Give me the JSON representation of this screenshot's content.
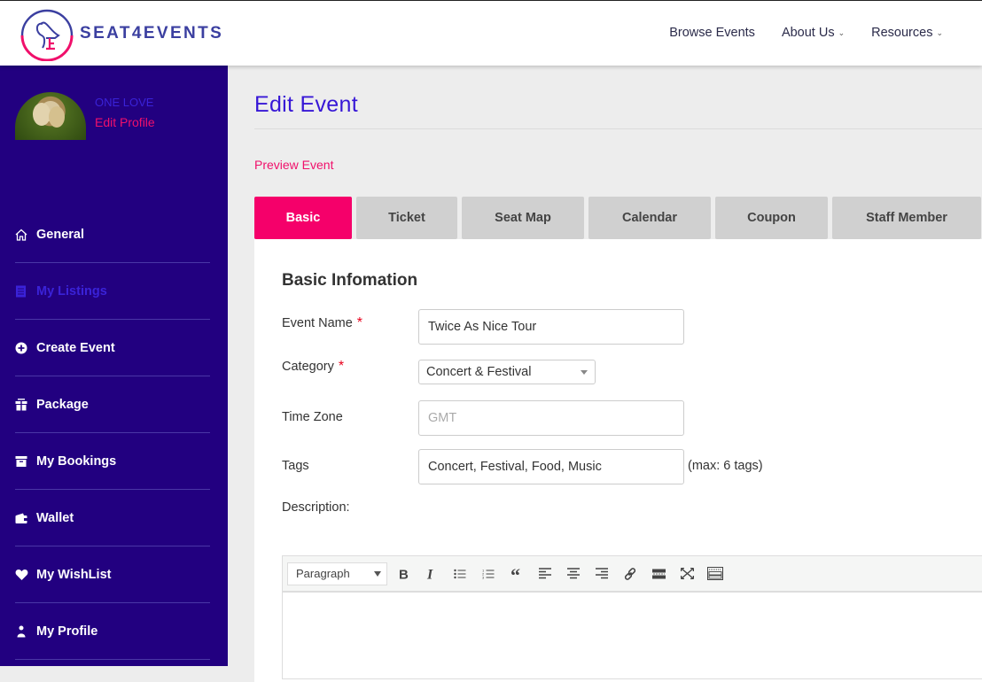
{
  "brand": {
    "name": "SEAT4EVENTS",
    "colors": {
      "primary": "#220080",
      "accent": "#f5006a",
      "title": "#3717d6"
    }
  },
  "nav": {
    "items": [
      {
        "label": "Browse Events",
        "has_dropdown": false
      },
      {
        "label": "About Us",
        "has_dropdown": true
      },
      {
        "label": "Resources",
        "has_dropdown": true
      }
    ]
  },
  "sidebar": {
    "user_name": "ONE LOVE",
    "edit_profile": "Edit Profile",
    "items": [
      {
        "label": "General",
        "icon": "home-icon",
        "active": false
      },
      {
        "label": "My Listings",
        "icon": "list-icon",
        "active": true
      },
      {
        "label": "Create Event",
        "icon": "plus-circle-icon",
        "active": false
      },
      {
        "label": "Package",
        "icon": "gift-icon",
        "active": false
      },
      {
        "label": "My Bookings",
        "icon": "archive-icon",
        "active": false
      },
      {
        "label": "Wallet",
        "icon": "wallet-icon",
        "active": false
      },
      {
        "label": "My WishList",
        "icon": "heart-icon",
        "active": false
      },
      {
        "label": "My Profile",
        "icon": "user-icon",
        "active": false
      }
    ]
  },
  "main": {
    "title": "Edit Event",
    "preview_link": "Preview Event",
    "tabs": [
      {
        "label": "Basic",
        "active": true
      },
      {
        "label": "Ticket",
        "active": false
      },
      {
        "label": "Seat Map",
        "active": false
      },
      {
        "label": "Calendar",
        "active": false
      },
      {
        "label": "Coupon",
        "active": false
      },
      {
        "label": "Staff Member",
        "active": false
      }
    ],
    "form": {
      "section_title": "Basic Infomation",
      "event_name": {
        "label": "Event Name",
        "required": "*",
        "value": "Twice As Nice Tour"
      },
      "category": {
        "label": "Category",
        "required": "*",
        "value": "Concert & Festival"
      },
      "time_zone": {
        "label": "Time Zone",
        "placeholder": "GMT"
      },
      "tags": {
        "label": "Tags",
        "value": "Concert, Festival, Food, Music",
        "hint": "(max: 6 tags)"
      },
      "description": {
        "label": "Description:",
        "format_select": "Paragraph",
        "toolbar": [
          "bold",
          "italic",
          "bullet-list",
          "numbered-list",
          "blockquote",
          "align-left",
          "align-center",
          "align-right",
          "link",
          "horizontal-rule",
          "fullscreen",
          "keyboard"
        ]
      }
    }
  }
}
